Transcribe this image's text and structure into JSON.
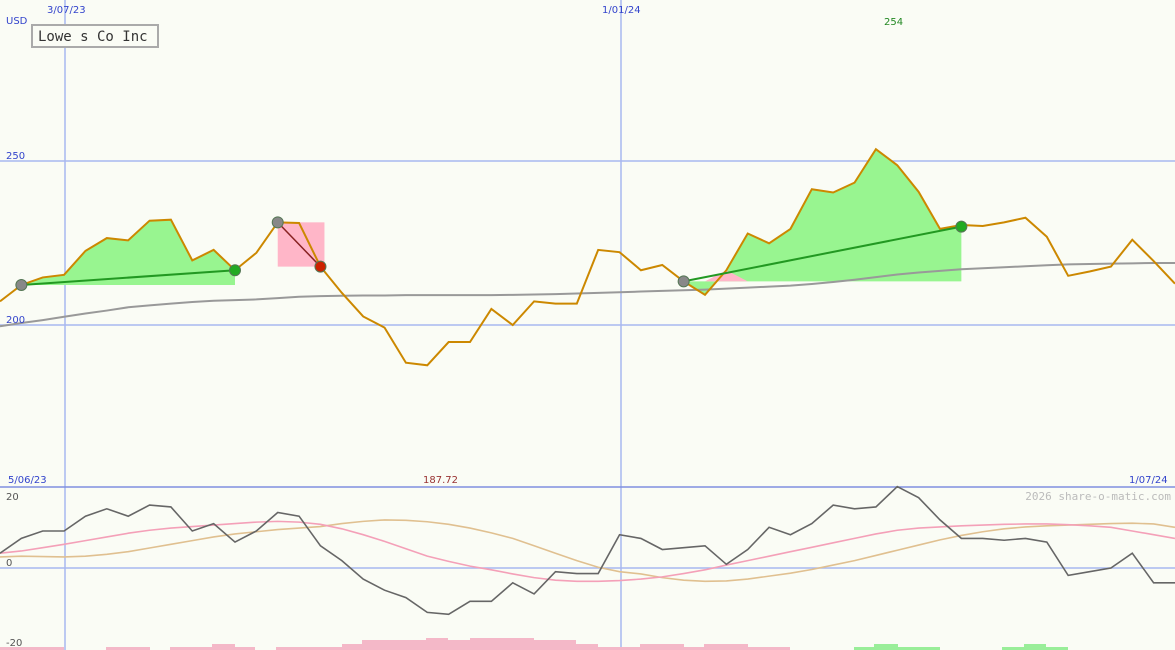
{
  "chart_data": {
    "type": "line",
    "title": "Lowe s Co Inc",
    "currency": "USD",
    "price_axis": {
      "ticks": [
        250,
        200
      ],
      "ylim": [
        150,
        300
      ]
    },
    "date_labels": {
      "top_left": "3/07/23",
      "top_mid": "1/01/24",
      "bottom_left": "5/06/23",
      "bottom_right": "1/07/24"
    },
    "max_label": "254",
    "min_label": "187.72",
    "copyright": "2026 share-o-matic.com",
    "x": [
      0,
      1,
      2,
      3,
      4,
      5,
      6,
      7,
      8,
      9,
      10,
      11,
      12,
      13,
      14,
      15,
      16,
      17,
      18,
      19,
      20,
      21,
      22,
      23,
      24,
      25,
      26,
      27,
      28,
      29,
      30,
      31,
      32,
      33,
      34,
      35,
      36,
      37,
      38,
      39,
      40,
      41,
      42,
      43,
      44,
      45,
      46,
      47,
      48,
      49,
      50,
      51,
      52,
      53,
      54,
      55
    ],
    "series": [
      {
        "color": "#cc8800",
        "values": [
          207.2,
          212.2,
          214.5,
          215.3,
          222.6,
          226.5,
          225.8,
          231.8,
          232.1,
          219.7,
          222.9,
          216.7,
          222.0,
          231.3,
          231.1,
          217.8,
          209.8,
          202.6,
          199.2,
          188.5,
          187.72,
          194.8,
          194.8,
          204.9,
          200.0,
          207.2,
          206.5,
          206.5,
          222.9,
          222.2,
          216.7,
          218.3,
          213.3,
          209.2,
          216.7,
          227.9,
          224.9,
          229.3,
          241.4,
          240.4,
          243.4,
          253.6,
          248.7,
          240.6,
          229.3,
          230.5,
          230.2,
          231.3,
          232.7,
          226.9,
          215.0,
          216.3,
          217.8,
          226.0,
          219.5,
          212.6
        ]
      },
      {
        "color": "#999999",
        "values": [
          199.6,
          200.6,
          201.5,
          202.5,
          203.5,
          204.4,
          205.4,
          206.0,
          206.5,
          207.0,
          207.4,
          207.6,
          207.8,
          208.2,
          208.6,
          208.8,
          208.9,
          209.0,
          209.0,
          209.1,
          209.1,
          209.1,
          209.1,
          209.1,
          209.2,
          209.3,
          209.4,
          209.6,
          209.8,
          210.0,
          210.2,
          210.4,
          210.6,
          210.8,
          211.1,
          211.4,
          211.7,
          212.0,
          212.5,
          213.1,
          213.8,
          214.6,
          215.4,
          216.0,
          216.5,
          217.0,
          217.3,
          217.6,
          217.9,
          218.2,
          218.5,
          218.6,
          218.7,
          218.8,
          218.9,
          218.9
        ]
      }
    ],
    "markers": [
      {
        "i": 1,
        "v": 212.2,
        "color": "#888888"
      },
      {
        "i": 11,
        "v": 216.7,
        "color": "#22aa22"
      },
      {
        "i": 13,
        "v": 231.3,
        "color": "#888888"
      },
      {
        "i": 15,
        "v": 217.8,
        "color": "#cc2200"
      },
      {
        "i": 32,
        "v": 213.3,
        "color": "#888888"
      },
      {
        "i": 45,
        "v": 230.0,
        "color": "#22aa22"
      }
    ],
    "oscillator": {
      "ylim": [
        -20,
        20
      ],
      "ticks": [
        20,
        0,
        -20
      ],
      "series": [
        {
          "color": "#666666",
          "values": [
            4,
            8,
            10,
            10,
            14,
            16,
            14,
            17,
            16.5,
            10,
            12,
            7,
            10,
            15,
            14,
            6,
            2,
            -3,
            -6,
            -8,
            -12,
            -12.5,
            -9,
            -9,
            -4,
            -7,
            -1,
            -1.5,
            -1.5,
            9,
            8,
            5,
            5.5,
            6,
            1,
            5,
            11,
            9,
            12,
            17,
            16,
            16.5,
            22,
            19,
            13,
            8,
            8,
            7.5,
            8,
            7,
            -2,
            -1,
            0,
            4,
            -4,
            -4
          ]
        },
        {
          "color": "#f4a0b8",
          "values": [
            4,
            4.6,
            5.5,
            6.4,
            7.4,
            8.4,
            9.4,
            10.2,
            10.8,
            11.2,
            11.6,
            12,
            12.4,
            12.6,
            12.4,
            11.8,
            10.6,
            9,
            7.2,
            5.2,
            3.2,
            1.8,
            0.5,
            -0.5,
            -1.6,
            -2.6,
            -3.3,
            -3.6,
            -3.6,
            -3.4,
            -3,
            -2.4,
            -1.5,
            -0.5,
            0.8,
            2,
            3.2,
            4.4,
            5.6,
            6.8,
            8,
            9.2,
            10.2,
            10.8,
            11.1,
            11.4,
            11.6,
            11.8,
            11.9,
            11.9,
            11.7,
            11.4,
            11,
            10,
            9,
            8
          ]
        },
        {
          "color": "#e0c090",
          "values": [
            3,
            3.2,
            3.1,
            3,
            3.2,
            3.7,
            4.4,
            5.4,
            6.4,
            7.4,
            8.4,
            9.2,
            9.8,
            10.4,
            10.8,
            11.2,
            12,
            12.6,
            13,
            12.9,
            12.5,
            11.8,
            10.8,
            9.5,
            8,
            6,
            4,
            2,
            0.2,
            -1,
            -1.6,
            -2.6,
            -3.3,
            -3.6,
            -3.5,
            -3,
            -2.2,
            -1.4,
            -0.4,
            0.8,
            2,
            3.4,
            4.8,
            6.2,
            7.6,
            8.8,
            9.8,
            10.6,
            11.1,
            11.4,
            11.6,
            11.8,
            12,
            12.1,
            11.9,
            11
          ]
        }
      ]
    },
    "volume_bars": [
      {
        "x0": 0,
        "x1": 64,
        "h": 3,
        "color": "#f4b8c8"
      },
      {
        "x0": 106,
        "x1": 150,
        "h": 3,
        "color": "#f4b8c8"
      },
      {
        "x0": 170,
        "x1": 212,
        "h": 3,
        "color": "#f4b8c8"
      },
      {
        "x0": 212,
        "x1": 235,
        "h": 6,
        "color": "#f4b8c8"
      },
      {
        "x0": 235,
        "x1": 255,
        "h": 3,
        "color": "#f4b8c8"
      },
      {
        "x0": 276,
        "x1": 342,
        "h": 3,
        "color": "#f4b8c8"
      },
      {
        "x0": 342,
        "x1": 362,
        "h": 6,
        "color": "#f4b8c8"
      },
      {
        "x0": 362,
        "x1": 426,
        "h": 10,
        "color": "#f4b8c8"
      },
      {
        "x0": 426,
        "x1": 448,
        "h": 12,
        "color": "#f4b8c8"
      },
      {
        "x0": 448,
        "x1": 470,
        "h": 10,
        "color": "#f4b8c8"
      },
      {
        "x0": 470,
        "x1": 534,
        "h": 12,
        "color": "#f4b8c8"
      },
      {
        "x0": 534,
        "x1": 576,
        "h": 10,
        "color": "#f4b8c8"
      },
      {
        "x0": 576,
        "x1": 598,
        "h": 6,
        "color": "#f4b8c8"
      },
      {
        "x0": 598,
        "x1": 640,
        "h": 3,
        "color": "#f4b8c8"
      },
      {
        "x0": 640,
        "x1": 684,
        "h": 6,
        "color": "#f4b8c8"
      },
      {
        "x0": 684,
        "x1": 704,
        "h": 3,
        "color": "#f4b8c8"
      },
      {
        "x0": 704,
        "x1": 748,
        "h": 6,
        "color": "#f4b8c8"
      },
      {
        "x0": 748,
        "x1": 790,
        "h": 3,
        "color": "#f4b8c8"
      },
      {
        "x0": 854,
        "x1": 874,
        "h": 3,
        "color": "#99ee99"
      },
      {
        "x0": 874,
        "x1": 898,
        "h": 6,
        "color": "#99ee99"
      },
      {
        "x0": 898,
        "x1": 940,
        "h": 3,
        "color": "#99ee99"
      },
      {
        "x0": 1002,
        "x1": 1024,
        "h": 3,
        "color": "#99ee99"
      },
      {
        "x0": 1024,
        "x1": 1046,
        "h": 6,
        "color": "#99ee99"
      },
      {
        "x0": 1046,
        "x1": 1068,
        "h": 3,
        "color": "#99ee99"
      }
    ]
  }
}
